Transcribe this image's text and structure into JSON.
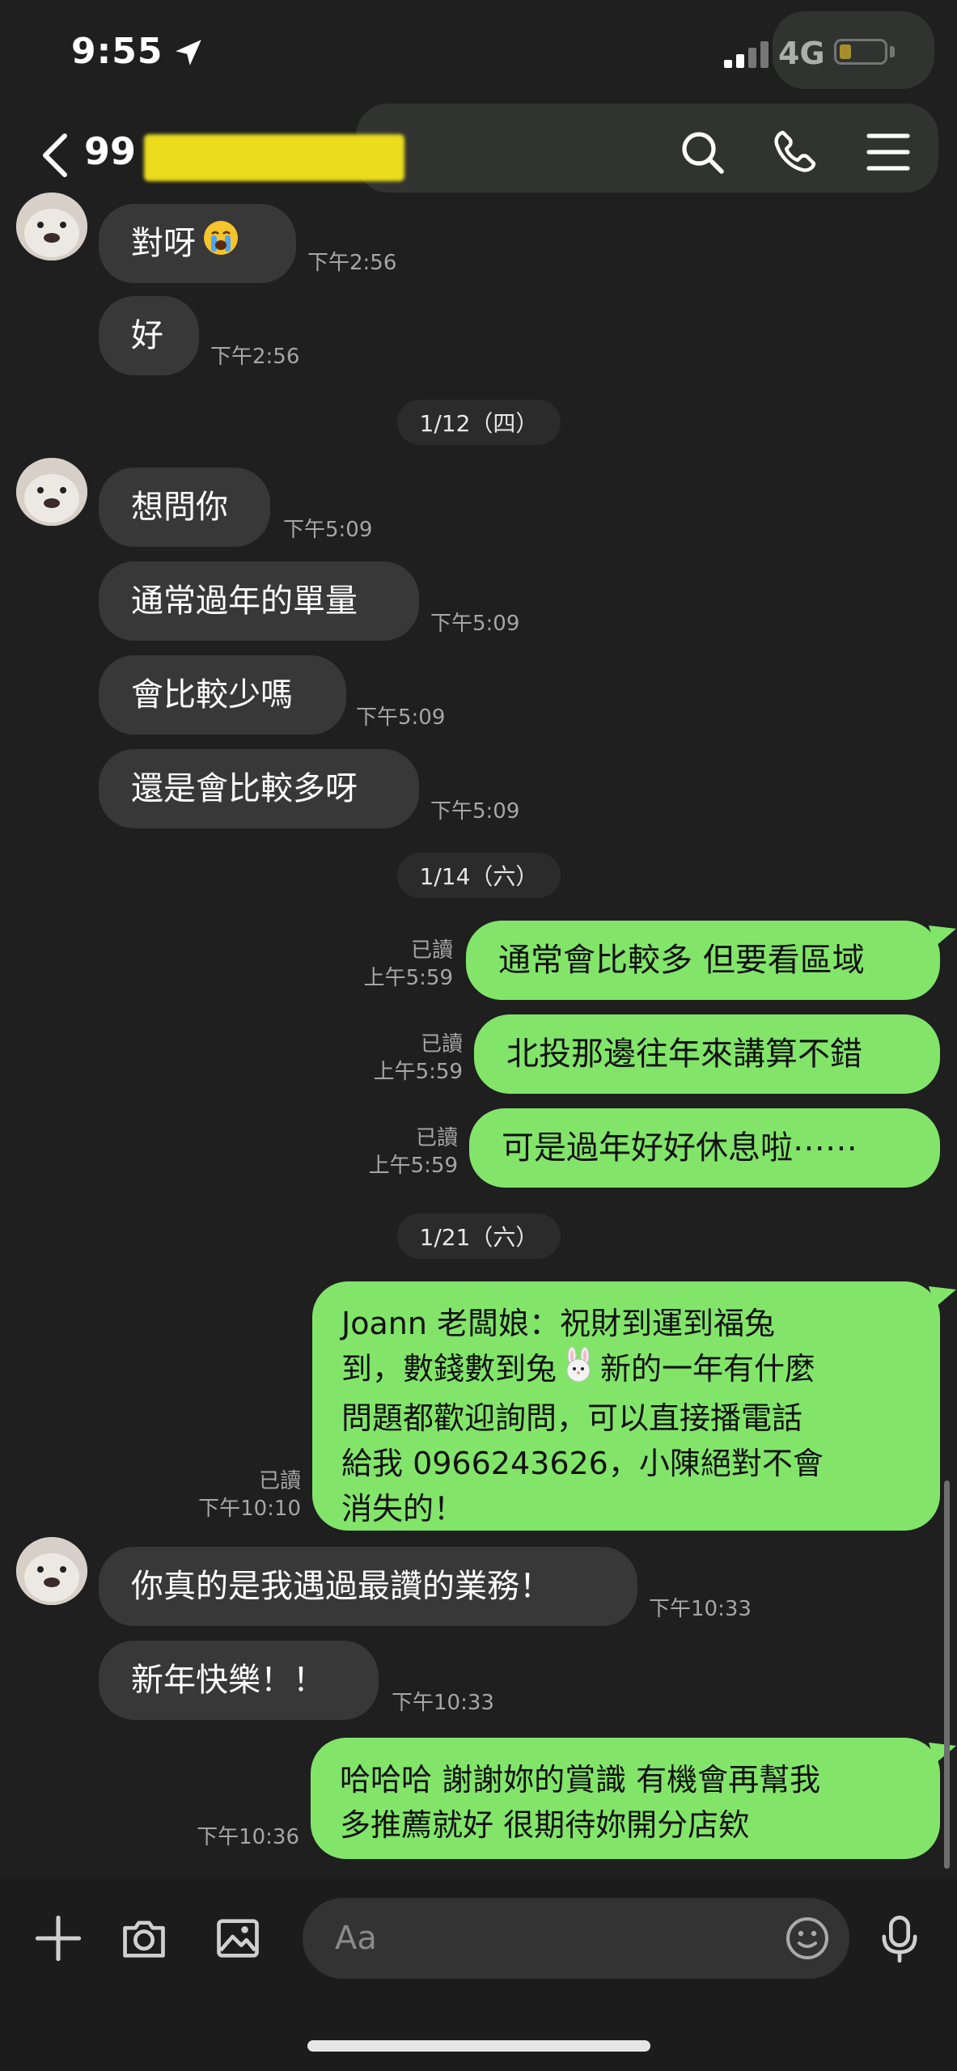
{
  "status_bar": {
    "time": "9:55",
    "network": "4G",
    "battery_level": 0.25
  },
  "header": {
    "title_visible": "99",
    "icons": [
      "back-icon",
      "search-icon",
      "phone-icon",
      "menu-icon"
    ]
  },
  "messages": [
    {
      "dir": "in",
      "text": "對呀",
      "time": "下午2:56",
      "emoji": "crying-face"
    },
    {
      "dir": "in",
      "text": "好",
      "time": "下午2:56"
    },
    {
      "type": "date",
      "text": "1/12（四）"
    },
    {
      "dir": "in",
      "text": "想問你",
      "time": "下午5:09"
    },
    {
      "dir": "in",
      "text": "通常過年的單量",
      "time": "下午5:09"
    },
    {
      "dir": "in",
      "text": "會比較少嗎",
      "time": "下午5:09"
    },
    {
      "dir": "in",
      "text": "還是會比較多呀",
      "time": "下午5:09"
    },
    {
      "type": "date",
      "text": "1/14（六）"
    },
    {
      "dir": "out",
      "text": "通常會比較多 但要看區域",
      "read": "已讀",
      "time": "上午5:59"
    },
    {
      "dir": "out",
      "text": "北投那邊往年來講算不錯",
      "read": "已讀",
      "time": "上午5:59"
    },
    {
      "dir": "out",
      "text": "可是過年好好休息啦⋯⋯",
      "read": "已讀",
      "time": "上午5:59"
    },
    {
      "type": "date",
      "text": "1/21（六）"
    },
    {
      "dir": "out",
      "lines": [
        "Joann 老闆娘：祝財到運到福兔",
        "到，數錢數到兔",
        "新的一年有什麼",
        "問題都歡迎詢問，可以直接播電話",
        "給我 0966243626，小陳絕對不會",
        "消失的！"
      ],
      "emoji": "rabbit-face",
      "read": "已讀",
      "time": "下午10:10"
    },
    {
      "dir": "in",
      "text": "你真的是我遇過最讚的業務！",
      "time": "下午10:33"
    },
    {
      "dir": "in",
      "text": "新年快樂！！",
      "time": "下午10:33"
    },
    {
      "dir": "out",
      "lines": [
        "哈哈哈 謝謝妳的賞識 有機會再幫我",
        "多推薦就好 很期待妳開分店欸"
      ],
      "time": "下午10:36"
    }
  ],
  "composer": {
    "placeholder": "Aa"
  },
  "colors": {
    "background": "#1f1f1f",
    "incoming_bubble": "#383838",
    "outgoing_bubble": "#82e56a",
    "meta_text": "#a6a6a6"
  }
}
